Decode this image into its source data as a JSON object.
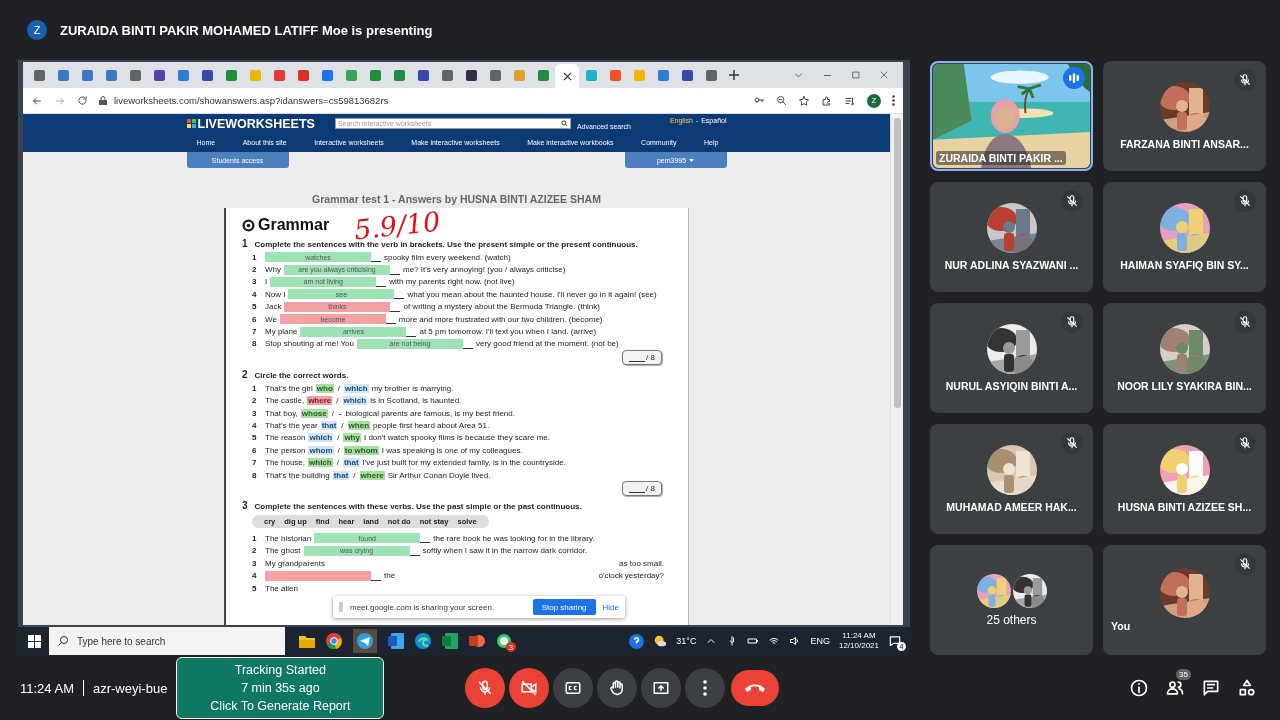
{
  "presenter_banner": {
    "avatar": "Z",
    "text": "ZURAIDA BINTI PAKIR MOHAMED LATIFF Moe is presenting"
  },
  "browser": {
    "tabs": [
      {
        "selected": false,
        "color": "#5f6368"
      },
      {
        "selected": false,
        "color": "#3b78c2"
      },
      {
        "selected": false,
        "color": "#3b78c2"
      },
      {
        "selected": false,
        "color": "#3b78c2"
      },
      {
        "selected": false,
        "color": "#5f6368"
      },
      {
        "selected": false,
        "color": "#5b3fa8"
      },
      {
        "selected": false,
        "color": "#2b7cd3"
      },
      {
        "selected": false,
        "color": "#3949ab"
      },
      {
        "selected": false,
        "color": "#1e8e3e"
      },
      {
        "selected": false,
        "color": "#f2b400"
      },
      {
        "selected": false,
        "color": "#e53935"
      },
      {
        "selected": false,
        "color": "#d93025"
      },
      {
        "selected": false,
        "color": "#1a73e8"
      },
      {
        "selected": false,
        "color": "#34a853"
      },
      {
        "selected": false,
        "color": "#1e8e3e"
      },
      {
        "selected": false,
        "color": "#1e8e3e"
      },
      {
        "selected": false,
        "color": "#3949ab"
      },
      {
        "selected": false,
        "color": "#5f6368"
      },
      {
        "selected": false,
        "color": "#3a2a4a"
      },
      {
        "selected": false,
        "color": "#5f6368"
      },
      {
        "selected": false,
        "color": "#e0a030"
      },
      {
        "selected": false,
        "color": "#1e8e3e"
      },
      {
        "selected": true
      },
      {
        "selected": false,
        "color": "#20b2c8"
      },
      {
        "selected": false,
        "color": "#f25022"
      },
      {
        "selected": false,
        "color": "#f4b400"
      },
      {
        "selected": false,
        "color": "#2b7cd3"
      },
      {
        "selected": false,
        "color": "#3949ab"
      },
      {
        "selected": false,
        "color": "#5f6368"
      }
    ],
    "url": "liveworksheets.com/showanswers.asp?idanswers=cs59813682rs",
    "profile": "Z"
  },
  "site": {
    "logo": "LIVEWORKSHEETS",
    "search_placeholder": "Search interactive worksheets",
    "advanced_search": "Advanced search",
    "languages": [
      "English",
      "-",
      "Español"
    ],
    "nav": [
      "Home",
      "About this site",
      "Interactive worksheets",
      "Make interactive worksheets",
      "Make interactive workbooks",
      "Community",
      "Help"
    ],
    "students_access": "Students access",
    "user_menu": "pem3995"
  },
  "worksheet": {
    "title": "Grammar test 1 - Answers by HUSNA BINTI AZIZEE SHAM",
    "heading": "Grammar",
    "score_mark": "5.9/10",
    "separator": "/",
    "sections": [
      {
        "kind": "fill",
        "number": "1",
        "instruction": "Complete the sentences with the verb in brackets. Use the present simple or the present continuous.",
        "score": "/ 8",
        "items": [
          {
            "number": "1",
            "answer": "watches",
            "correct": true,
            "after": "spooky film every weekend. (watch)"
          },
          {
            "number": "2",
            "before": "Why",
            "answer": "are you always criticising",
            "correct": true,
            "after": "me? It's very annoying! (you / always criticise)"
          },
          {
            "number": "3",
            "before": "I",
            "answer": "am not living",
            "correct": true,
            "after": "with my parents right now. (not live)"
          },
          {
            "number": "4",
            "before": "Now I",
            "answer": "see",
            "correct": true,
            "after": "what you mean about the haunted house. I'll never go in it again! (see)"
          },
          {
            "number": "5",
            "before": "Jack",
            "answer": "thinks",
            "correct": false,
            "after": "of writing a mystery about the Bermuda Triangle. (think)"
          },
          {
            "number": "6",
            "before": "We",
            "answer": "become",
            "correct": false,
            "after": "more and more frustrated with our two children. (become)"
          },
          {
            "number": "7",
            "before": "My plane",
            "answer": "arrives",
            "correct": true,
            "after": "at 5 pm tomorrow. I'll text you when I land. (arrive)"
          },
          {
            "number": "8",
            "before": "Stop shouting at me! You",
            "answer": "are not being",
            "correct": true,
            "after": "very good friend at the moment. (not be)"
          }
        ]
      },
      {
        "kind": "choose",
        "number": "2",
        "instruction": "Circle the correct words.",
        "score": "/ 8",
        "items": [
          {
            "number": "1",
            "before": "That's the girl",
            "options": [
              {
                "text": "who",
                "chosen": true,
                "correct": true
              },
              {
                "text": "which",
                "chosen": false
              }
            ],
            "after": "my brother is marrying."
          },
          {
            "number": "2",
            "before": "The castle,",
            "options": [
              {
                "text": "where",
                "chosen": true,
                "correct": false
              },
              {
                "text": "which",
                "chosen": false
              }
            ],
            "after": "is in Scotland, is haunted."
          },
          {
            "number": "3",
            "before": "That boy,",
            "options": [
              {
                "text": "whose",
                "chosen": true,
                "correct": true
              },
              {
                "text": "-"
              }
            ],
            "after": "biological parents are famous, is my best friend."
          },
          {
            "number": "4",
            "before": "That's the year",
            "options": [
              {
                "text": "that",
                "chosen": false
              },
              {
                "text": "when",
                "chosen": true,
                "correct": true
              }
            ],
            "after": "people first heard about Area 51."
          },
          {
            "number": "5",
            "before": "The reason",
            "options": [
              {
                "text": "which",
                "chosen": false
              },
              {
                "text": "why",
                "chosen": true,
                "correct": true
              }
            ],
            "after": "I don't watch spooky films is because they scare me."
          },
          {
            "number": "6",
            "before": "The person",
            "options": [
              {
                "text": "whom",
                "chosen": false
              },
              {
                "text": "to whom",
                "chosen": true,
                "correct": true
              }
            ],
            "after": "I was speaking is one of my colleagues."
          },
          {
            "number": "7",
            "before": "The house,",
            "options": [
              {
                "text": "which",
                "chosen": true,
                "correct": true
              },
              {
                "text": "that",
                "chosen": false
              }
            ],
            "after": "I've just built for my extended family, is in the countryside."
          },
          {
            "number": "8",
            "before": "That's the building",
            "options": [
              {
                "text": "that",
                "chosen": false
              },
              {
                "text": "where",
                "chosen": true,
                "correct": true
              }
            ],
            "after": "Sir Arthur Conan Doyle lived."
          }
        ]
      },
      {
        "kind": "fill",
        "number": "3",
        "instruction": "Complete the sentences with these verbs. Use the past simple or the past continuous.",
        "word_bank": [
          "cry",
          "dig up",
          "find",
          "hear",
          "land",
          "not do",
          "not stay",
          "solve"
        ],
        "items": [
          {
            "number": "1",
            "before": "The historian",
            "answer": "found",
            "correct": true,
            "after": "the rare book he was looking for in the library."
          },
          {
            "number": "2",
            "before": "The ghost",
            "answer": "was crying",
            "correct": true,
            "after": "softly when I saw it in the narrow dark corridor."
          },
          {
            "number": "3",
            "before": "My grandparents",
            "after": "as too small."
          },
          {
            "number": "4",
            "correct": false,
            "middle": "the",
            "after": "o'clock yesterday?"
          },
          {
            "number": "5",
            "before": "The alien"
          }
        ]
      }
    ]
  },
  "share_notice": {
    "text": "meet.google.com is sharing your screen.",
    "stop": "Stop sharing",
    "hide": "Hide"
  },
  "taskbar": {
    "search_placeholder": "Type here to search",
    "whatsapp_badge": "3",
    "weather": "31°C",
    "language": "ENG",
    "time": "11:24 AM",
    "date": "12/10/2021",
    "notifications": "4"
  },
  "participants": [
    {
      "name": "ZURAIDA BINTI PAKIR ...",
      "kind": "video",
      "speaking": true,
      "muted": false
    },
    {
      "name": "FARZANA BINTI ANSAR...",
      "kind": "avatar",
      "speaking": false,
      "muted": true
    },
    {
      "name": "NUR ADLINA SYAZWANI ...",
      "kind": "avatar",
      "speaking": false,
      "muted": true
    },
    {
      "name": "HAIMAN SYAFIQ BIN SY...",
      "kind": "avatar",
      "speaking": false,
      "muted": true
    },
    {
      "name": "NURUL ASYIQIN BINTI A...",
      "kind": "avatar",
      "speaking": false,
      "muted": true
    },
    {
      "name": "NOOR LILY SYAKIRA BIN...",
      "kind": "avatar",
      "speaking": false,
      "muted": true
    },
    {
      "name": "MUHAMAD AMEER HAK...",
      "kind": "avatar",
      "speaking": false,
      "muted": true
    },
    {
      "name": "HUSNA BINTI AZIZEE SH...",
      "kind": "avatar",
      "speaking": false,
      "muted": true
    },
    {
      "name": "25 others",
      "kind": "others",
      "speaking": false,
      "muted": false
    },
    {
      "name": "You",
      "kind": "self",
      "speaking": false,
      "muted": true
    }
  ],
  "meeting_bar": {
    "time": "11:24 AM",
    "code": "azr-weyi-bue",
    "tracking": [
      "Tracking Started",
      "7 min 35s ago",
      "Click To Generate Report"
    ],
    "people_count": "35"
  }
}
